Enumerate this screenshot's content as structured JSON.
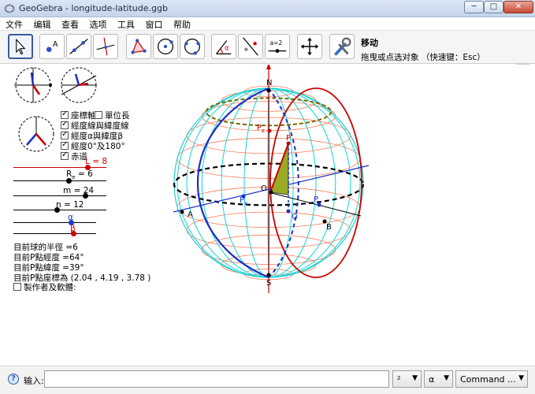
{
  "window": {
    "title": "GeoGebra - longitude-latitude.ggb",
    "min_glyph": "─",
    "max_glyph": "□",
    "close_glyph": "✕"
  },
  "menu": [
    "文件",
    "编辑",
    "查看",
    "选项",
    "工具",
    "窗口",
    "帮助"
  ],
  "toolbar": {
    "tools": [
      "move-tool",
      "point-tool",
      "line-tool",
      "perpendicular-tool",
      "polygon-tool",
      "circle-tool",
      "conic-tool",
      "angle-tool",
      "reflect-tool",
      "slider-tool",
      "move-graphics-tool",
      "settings-tool"
    ],
    "slider_tool_label": "a=2",
    "active_tool_name": "移动",
    "active_tool_help": "拖曳或点选对象 （快速键：Esc）",
    "undo_glyph": "↶",
    "redo_glyph": "↷"
  },
  "panel": {
    "checkboxes": [
      {
        "label": "座標軸",
        "checked": true
      },
      {
        "label": "單位長",
        "checked": false
      },
      {
        "label": "經度線與緯度線",
        "checked": true
      },
      {
        "label": "經度α與緯度β",
        "checked": true
      },
      {
        "label": "經度0°及180°",
        "checked": true
      },
      {
        "label": "赤道",
        "checked": true
      }
    ],
    "sliders": [
      {
        "label": "L = 8",
        "value": 8,
        "color": "#cc0000"
      },
      {
        "label_main": "R",
        "label_sub": "e",
        "label_rest": " = 6",
        "value": 6,
        "color": "#000000"
      },
      {
        "label": "m = 24",
        "value": 24,
        "color": "#000000"
      },
      {
        "label": "n = 12",
        "value": 12,
        "color": "#000000"
      },
      {
        "label": "α",
        "value": 64,
        "color": "#1a3fcc"
      },
      {
        "label": "β",
        "value": 39,
        "color": "#cc0000"
      }
    ],
    "info": [
      "目前球的半徑 =6",
      "目前P點經度 =64°",
      "目前P點緯度 =39°",
      "目前P點座標為 (2.04 , 4.19 , 3.78 )"
    ],
    "author_checkbox": {
      "label": "製作者及軟體:",
      "checked": false
    }
  },
  "graphics": {
    "labels": {
      "north": "N",
      "south": "S",
      "a": "A",
      "b": "B",
      "o": "O",
      "q": "Q",
      "p": "P",
      "pz": "P",
      "pz_sub": "z",
      "px": "P",
      "px_sub": "x",
      "py": "P",
      "py_sub": "y"
    },
    "colors": {
      "meridian": "#00d8d8",
      "parallel": "#ff7a5a",
      "prime_meridian": "#cc0000",
      "longitude_alpha": "#1a2fc8",
      "equator": "#000000",
      "latitude_beta": "#cc3300",
      "axis_x": "#1a2fc8",
      "axis_z": "#cc0000",
      "fill": "#9aaa22"
    }
  },
  "inputbar": {
    "label": "输入:",
    "value": "",
    "dropdowns": [
      "²",
      "α",
      "Command ..."
    ]
  }
}
